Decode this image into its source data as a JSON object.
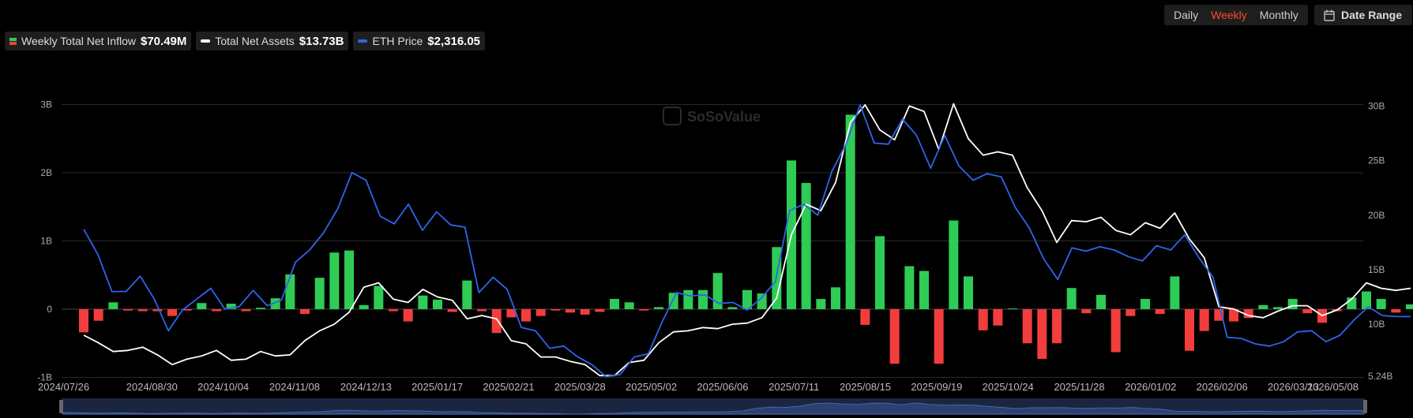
{
  "legend": {
    "inflow_label": "Weekly Total Net Inflow",
    "inflow_value": "$70.49M",
    "assets_label": "Total Net Assets",
    "assets_value": "$13.73B",
    "price_label": "ETH Price",
    "price_value": "$2,316.05"
  },
  "period_tabs": [
    "Daily",
    "Weekly",
    "Monthly"
  ],
  "active_period": "Weekly",
  "date_range_label": "Date Range",
  "watermark": "SoSoValue",
  "colors": {
    "positive": "#2ecc55",
    "negative": "#f23d3d",
    "assets_line": "#ffffff",
    "price_line": "#2f64ea",
    "active_tab": "#ff4a2d"
  },
  "chart_data": {
    "type": "bar+line",
    "title": "",
    "grid": true,
    "legend_position": "top-left",
    "left_axis": {
      "ticks": [
        "-1B",
        "0",
        "1B",
        "2B",
        "3B"
      ],
      "range": [
        -1,
        3
      ],
      "unit": "B"
    },
    "right_axis": {
      "ticks": [
        "5.24B",
        "10B",
        "15B",
        "20B",
        "25B",
        "30B"
      ],
      "range": [
        5.24,
        30.1
      ],
      "unit": "B"
    },
    "x_tick_labels": [
      "2024/07/26",
      "2024/08/30",
      "2024/10/04",
      "2024/11/08",
      "2024/12/13",
      "2025/01/17",
      "2025/02/21",
      "2025/03/28",
      "2025/05/02",
      "2025/06/06",
      "2025/07/11",
      "2025/08/15",
      "2025/09/19",
      "2025/10/24",
      "2025/11/28",
      "2026/01/02",
      "2026/02/06",
      "2026/03/13",
      "2026/05/08"
    ],
    "weeks": 94,
    "series": [
      {
        "name": "Weekly Total Net Inflow",
        "type": "bar",
        "axis": "left",
        "values": [
          -0.34,
          -0.17,
          0.1,
          -0.02,
          -0.03,
          -0.03,
          -0.1,
          -0.02,
          0.09,
          -0.03,
          0.08,
          -0.03,
          0.02,
          0.16,
          0.51,
          -0.07,
          0.46,
          0.83,
          0.86,
          0.06,
          0.34,
          -0.03,
          -0.18,
          0.2,
          0.14,
          -0.04,
          0.42,
          -0.03,
          -0.35,
          -0.12,
          -0.18,
          -0.1,
          -0.02,
          -0.05,
          -0.08,
          -0.04,
          0.15,
          0.1,
          -0.02,
          0.03,
          0.24,
          0.28,
          0.28,
          0.53,
          0.03,
          0.28,
          0.23,
          0.91,
          2.18,
          1.85,
          0.15,
          0.32,
          2.85,
          -0.23,
          1.07,
          -0.8,
          0.63,
          0.56,
          -0.8,
          1.3,
          0.48,
          -0.31,
          -0.24,
          0.01,
          -0.5,
          -0.73,
          -0.5,
          0.31,
          -0.06,
          0.21,
          -0.63,
          -0.1,
          0.15,
          -0.07,
          0.48,
          -0.61,
          -0.32,
          -0.17,
          -0.18,
          -0.13,
          0.06,
          0.03,
          0.15,
          -0.06,
          -0.2,
          -0.03,
          0.17,
          0.26,
          0.15,
          -0.05,
          0.07
        ]
      },
      {
        "name": "Total Net Assets",
        "type": "line",
        "axis": "right",
        "values": [
          9.0,
          8.3,
          7.5,
          7.6,
          7.9,
          7.2,
          6.3,
          6.8,
          7.1,
          7.6,
          6.7,
          6.8,
          7.5,
          7.1,
          7.2,
          8.5,
          9.4,
          10.0,
          11.1,
          13.4,
          13.8,
          12.3,
          12.0,
          13.2,
          12.5,
          12.2,
          10.5,
          10.8,
          10.5,
          8.5,
          8.2,
          7.0,
          7.0,
          6.6,
          6.3,
          5.3,
          5.3,
          6.5,
          6.7,
          8.3,
          9.3,
          9.4,
          9.7,
          9.6,
          10.0,
          10.1,
          10.6,
          12.4,
          18.2,
          21.0,
          20.4,
          23.0,
          28.5,
          30.1,
          27.8,
          26.9,
          30.0,
          29.5,
          26.0,
          30.2,
          27.0,
          25.5,
          25.8,
          25.5,
          22.5,
          20.4,
          17.5,
          19.5,
          19.4,
          19.8,
          18.6,
          18.2,
          19.3,
          18.8,
          20.2,
          17.8,
          16.1,
          11.6,
          11.4,
          10.8,
          10.6,
          11.2,
          11.7,
          11.7,
          10.8,
          11.3,
          12.3,
          13.8,
          13.3,
          13.1,
          13.3
        ]
      },
      {
        "name": "ETH Price",
        "type": "line",
        "axis": "right",
        "values": [
          18.7,
          16.4,
          13.0,
          13.0,
          14.4,
          12.3,
          9.4,
          11.3,
          12.3,
          13.3,
          11.4,
          11.6,
          13.1,
          11.7,
          12.2,
          15.7,
          16.8,
          18.4,
          20.6,
          23.9,
          23.2,
          19.9,
          19.2,
          21.0,
          18.6,
          20.3,
          19.1,
          18.9,
          12.9,
          14.3,
          13.2,
          9.7,
          9.4,
          7.8,
          8.0,
          7.0,
          6.3,
          5.2,
          5.4,
          7.0,
          7.3,
          10.3,
          12.9,
          12.6,
          12.7,
          11.9,
          12.0,
          11.3,
          12.4,
          13.9,
          20.4,
          21.0,
          20.0,
          24.0,
          26.5,
          30.1,
          26.6,
          26.5,
          28.8,
          27.3,
          24.3,
          27.3,
          24.5,
          23.2,
          23.8,
          23.5,
          20.7,
          18.8,
          16.0,
          14.1,
          17.0,
          16.7,
          17.1,
          16.8,
          16.2,
          15.8,
          17.2,
          16.8,
          18.2,
          16.1,
          14.3,
          8.8,
          8.7,
          8.2,
          8.0,
          8.4,
          9.3,
          9.4,
          8.4,
          9.0,
          10.4,
          11.6,
          10.8,
          10.7,
          10.7
        ]
      }
    ]
  }
}
